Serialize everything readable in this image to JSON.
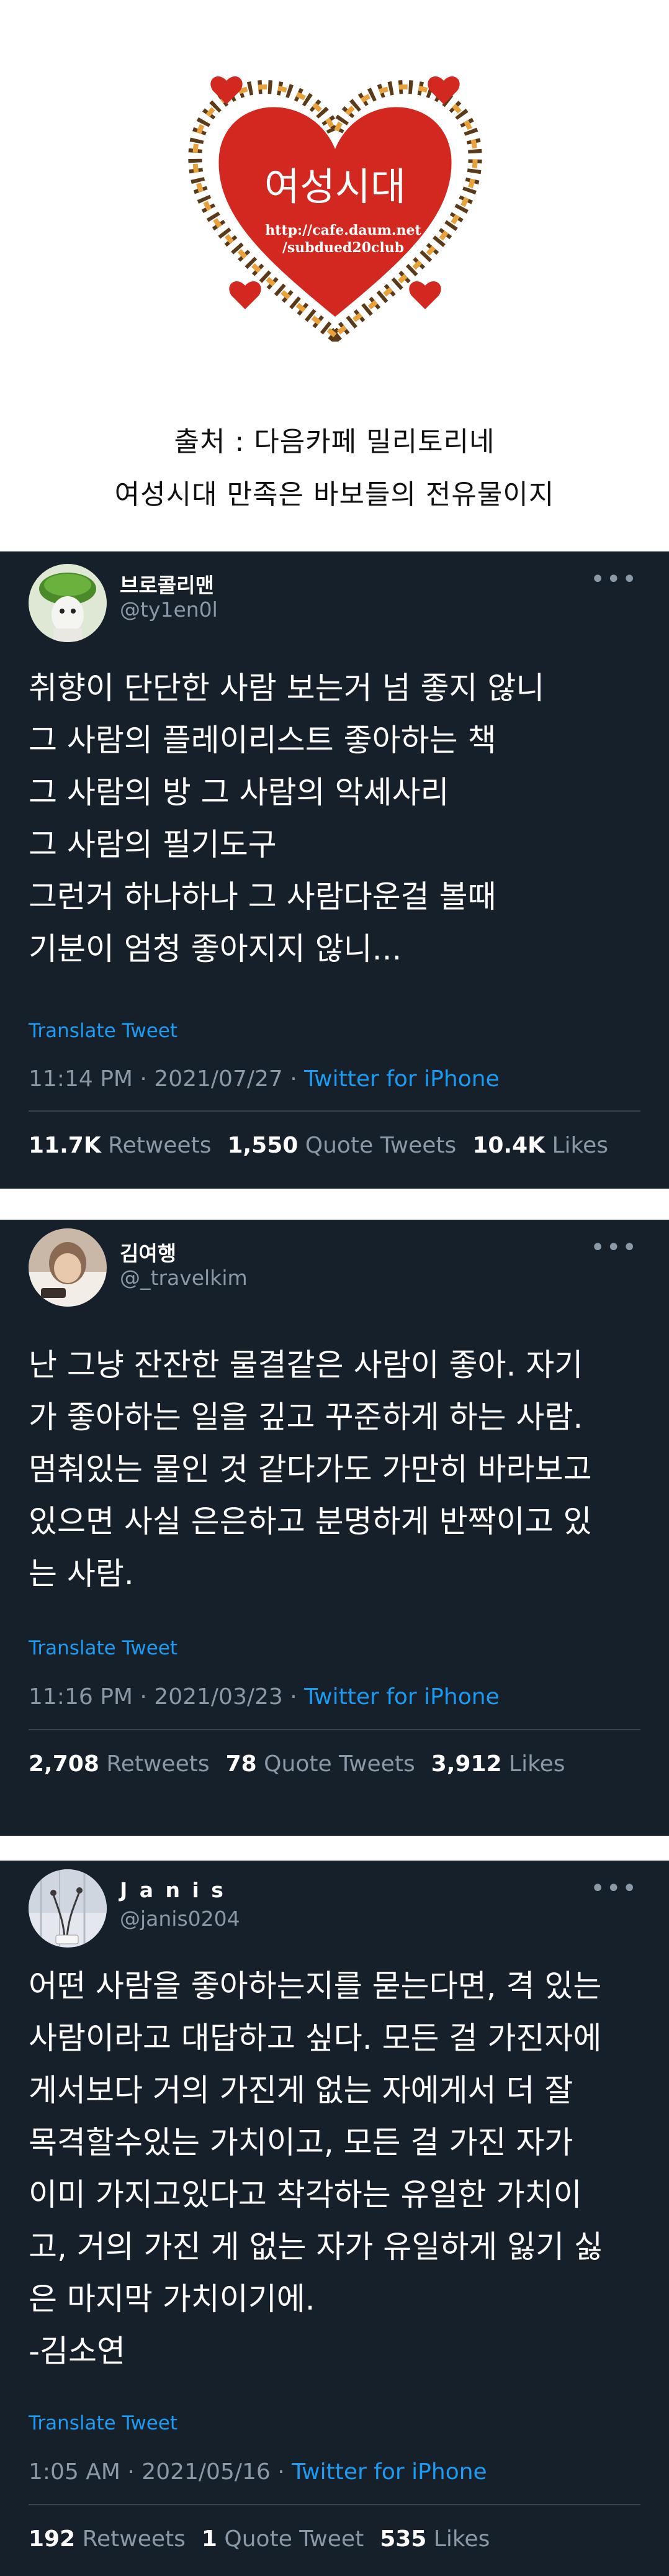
{
  "header": {
    "logo_title": "여성시대",
    "logo_url_line1": "http://cafe.daum.net",
    "logo_url_line2": "/subdued20club",
    "source_line1": "출처 : 다음카페 밀리토리네",
    "source_line2": "여성시대 만족은 바보들의 전유물이지"
  },
  "tweets": [
    {
      "name": "브로콜리맨",
      "handle": "@ty1en0l",
      "more": "•••",
      "text": "취향이 단단한 사람 보는거 넘 좋지 않니\n그 사람의 플레이리스트 좋아하는 책\n그 사람의 방 그 사람의 악세사리\n그 사람의 필기도구\n그런거 하나하나 그 사람다운걸 볼때\n기분이 엄청 좋아지지 않니...",
      "translate": "Translate Tweet",
      "time": "11:14 PM · 2021/07/27 · ",
      "app": "Twitter for iPhone",
      "retweets": "11.7K",
      "retweets_label": "Retweets",
      "quotes": "1,550",
      "quotes_label": "Quote Tweets",
      "likes": "10.4K",
      "likes_label": "Likes"
    },
    {
      "name": "김여행",
      "handle": "@_travelkim",
      "more": "•••",
      "text": "난 그냥 잔잔한 물결같은 사람이 좋아. 자기\n가 좋아하는 일을 깊고 꾸준하게 하는 사람.\n멈춰있는 물인 것 같다가도 가만히 바라보고\n있으면 사실 은은하고 분명하게 반짝이고 있\n는 사람.",
      "translate": "Translate Tweet",
      "time": "11:16 PM · 2021/03/23 · ",
      "app": "Twitter for iPhone",
      "retweets": "2,708",
      "retweets_label": "Retweets",
      "quotes": "78",
      "quotes_label": "Quote Tweets",
      "likes": "3,912",
      "likes_label": "Likes"
    },
    {
      "name": "J a n i s",
      "handle": "@janis0204",
      "more": "•••",
      "text": "어떤 사람을 좋아하는지를 묻는다면, 격 있는\n사람이라고 대답하고 싶다. 모든 걸 가진자에\n게서보다 거의 가진게 없는 자에게서 더 잘\n목격할수있는 가치이고, 모든 걸 가진 자가\n이미 가지고있다고 착각하는 유일한 가치이\n고, 거의 가진 게 없는 자가 유일하게 잃기 싫\n은 마지막 가치이기에.\n-김소연",
      "translate": "Translate Tweet",
      "time": "1:05 AM · 2021/05/16 · ",
      "app": "Twitter for iPhone",
      "retweets": "192",
      "retweets_label": "Retweets",
      "quotes": "1",
      "quotes_label": "Quote Tweet",
      "likes": "535",
      "likes_label": "Likes"
    }
  ]
}
